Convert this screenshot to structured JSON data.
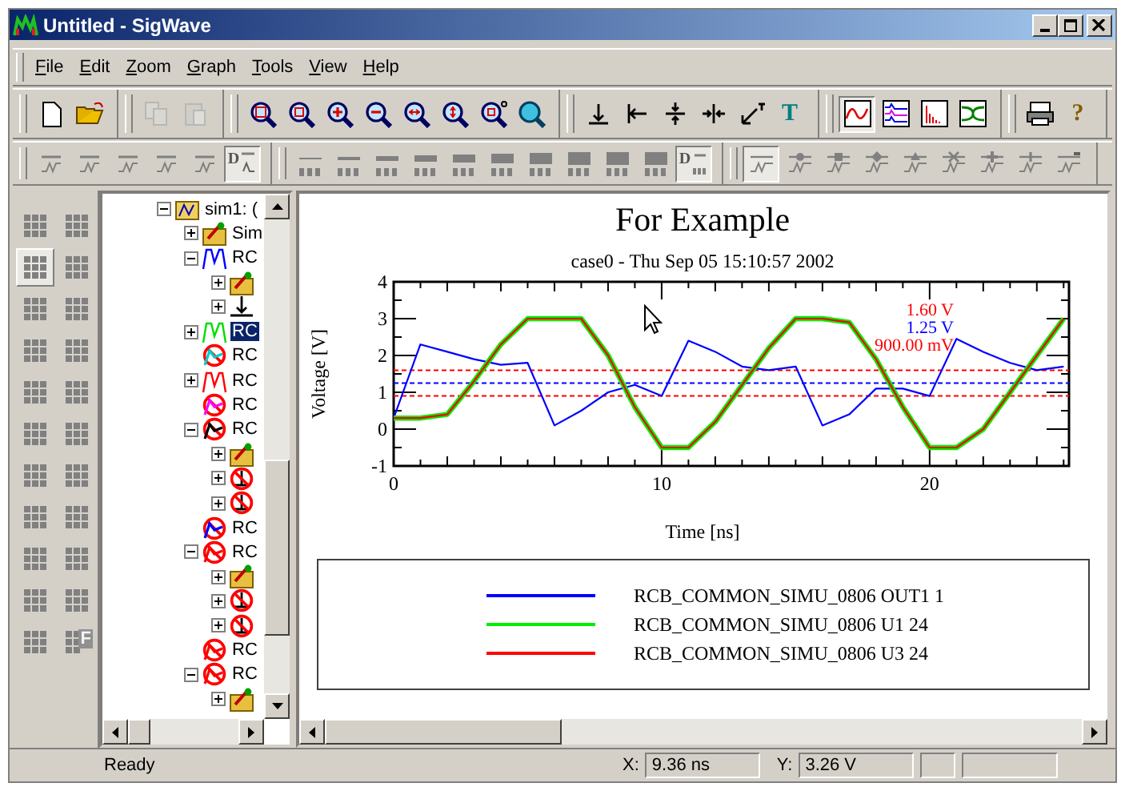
{
  "window": {
    "title": "Untitled - SigWave",
    "controls": [
      {
        "kind": "minimize"
      },
      {
        "kind": "maximize"
      },
      {
        "kind": "close"
      }
    ]
  },
  "menu": [
    {
      "label": "File"
    },
    {
      "label": "Edit"
    },
    {
      "label": "Zoom"
    },
    {
      "label": "Graph"
    },
    {
      "label": "Tools"
    },
    {
      "label": "View"
    },
    {
      "label": "Help"
    }
  ],
  "toolbars": [
    [
      {
        "buttons": [
          {
            "kind": "new",
            "pressed": false,
            "disabled": false
          },
          {
            "kind": "open",
            "pressed": false,
            "disabled": false
          }
        ]
      },
      {
        "buttons": [
          {
            "kind": "copy",
            "pressed": false,
            "disabled": true
          },
          {
            "kind": "paste",
            "pressed": false,
            "disabled": true
          }
        ]
      },
      {
        "buttons": [
          {
            "kind": "zoom-box",
            "pressed": false,
            "disabled": false
          },
          {
            "kind": "zoom-fit",
            "pressed": false,
            "disabled": false
          },
          {
            "kind": "zoom-in",
            "pressed": false,
            "disabled": false
          },
          {
            "kind": "zoom-out",
            "pressed": false,
            "disabled": false
          },
          {
            "kind": "zoom-x",
            "pressed": false,
            "disabled": false
          },
          {
            "kind": "zoom-y",
            "pressed": false,
            "disabled": false
          },
          {
            "kind": "zoom-step",
            "pressed": false,
            "disabled": false
          },
          {
            "kind": "zoom-all",
            "pressed": false,
            "disabled": false
          }
        ]
      },
      {
        "buttons": [
          {
            "kind": "marker-bottom",
            "pressed": false,
            "disabled": false
          },
          {
            "kind": "marker-left",
            "pressed": false,
            "disabled": false
          },
          {
            "kind": "marker-vcenter",
            "pressed": false,
            "disabled": false
          },
          {
            "kind": "marker-hcenter",
            "pressed": false,
            "disabled": false
          },
          {
            "kind": "marker-arrow",
            "pressed": false,
            "disabled": false
          },
          {
            "kind": "text-tool",
            "glyph": "T",
            "pressed": false,
            "disabled": false
          }
        ]
      },
      {
        "buttons": [
          {
            "kind": "view-wave",
            "pressed": true,
            "disabled": false
          },
          {
            "kind": "view-multi",
            "pressed": false,
            "disabled": false
          },
          {
            "kind": "view-spectrum",
            "pressed": false,
            "disabled": false
          },
          {
            "kind": "view-eye",
            "pressed": false,
            "disabled": false
          }
        ]
      },
      {
        "buttons": [
          {
            "kind": "print",
            "pressed": false,
            "disabled": false
          },
          {
            "kind": "help",
            "glyph": "?",
            "pressed": false,
            "disabled": false
          }
        ]
      }
    ],
    [
      {
        "buttons": [
          {
            "kind": "trace",
            "pressed": false,
            "disabled": false
          },
          {
            "kind": "trace",
            "pressed": false,
            "disabled": false
          },
          {
            "kind": "trace",
            "pressed": false,
            "disabled": false
          },
          {
            "kind": "trace",
            "pressed": false,
            "disabled": false
          },
          {
            "kind": "trace",
            "pressed": false,
            "disabled": false
          },
          {
            "kind": "label-trace",
            "glyph": "D",
            "pressed": true,
            "disabled": false
          }
        ]
      },
      {
        "buttons": [
          {
            "kind": "bar",
            "pressed": false,
            "disabled": false
          },
          {
            "kind": "bar",
            "pressed": false,
            "disabled": false
          },
          {
            "kind": "bar",
            "pressed": false,
            "disabled": false
          },
          {
            "kind": "bar",
            "pressed": false,
            "disabled": false
          },
          {
            "kind": "bar",
            "pressed": false,
            "disabled": false
          },
          {
            "kind": "bar",
            "pressed": false,
            "disabled": false
          },
          {
            "kind": "bar",
            "pressed": false,
            "disabled": false
          },
          {
            "kind": "bar",
            "pressed": false,
            "disabled": false
          },
          {
            "kind": "bar",
            "pressed": false,
            "disabled": false
          },
          {
            "kind": "bar",
            "pressed": false,
            "disabled": false
          },
          {
            "kind": "label-bar",
            "glyph": "D",
            "pressed": true,
            "disabled": false
          }
        ]
      },
      {
        "buttons": [
          {
            "kind": "point-plain",
            "pressed": true,
            "disabled": false
          },
          {
            "kind": "point-dot",
            "pressed": false,
            "disabled": false
          },
          {
            "kind": "point-square",
            "pressed": false,
            "disabled": false
          },
          {
            "kind": "point-diamond",
            "pressed": false,
            "disabled": false
          },
          {
            "kind": "point-triangle",
            "pressed": false,
            "disabled": false
          },
          {
            "kind": "point-cross",
            "pressed": false,
            "disabled": false
          },
          {
            "kind": "point-plus",
            "pressed": false,
            "disabled": false
          },
          {
            "kind": "point-tick",
            "pressed": false,
            "disabled": false
          },
          {
            "kind": "point-dash",
            "pressed": false,
            "disabled": false
          }
        ]
      }
    ]
  ],
  "palette": [
    {
      "kind": "grid",
      "selected": false
    },
    {
      "kind": "grid",
      "selected": false
    },
    {
      "kind": "grid",
      "selected": true
    },
    {
      "kind": "grid",
      "selected": false
    },
    {
      "kind": "grid",
      "selected": false
    },
    {
      "kind": "grid",
      "selected": false
    },
    {
      "kind": "grid",
      "selected": false
    },
    {
      "kind": "grid",
      "selected": false
    },
    {
      "kind": "grid",
      "selected": false
    },
    {
      "kind": "grid",
      "selected": false
    },
    {
      "kind": "grid",
      "selected": false
    },
    {
      "kind": "grid",
      "selected": false
    },
    {
      "kind": "grid",
      "selected": false
    },
    {
      "kind": "grid",
      "selected": false
    },
    {
      "kind": "grid",
      "selected": false
    },
    {
      "kind": "grid",
      "selected": false
    },
    {
      "kind": "grid",
      "selected": false
    },
    {
      "kind": "grid",
      "selected": false
    },
    {
      "kind": "grid",
      "selected": false
    },
    {
      "kind": "grid",
      "selected": false
    },
    {
      "kind": "grid",
      "selected": false
    },
    {
      "kind": "grid-label",
      "glyph": "F",
      "selected": false
    }
  ],
  "tree": [
    {
      "label": "sim1: (",
      "kind": "simulation",
      "expandable": true,
      "expanded": true,
      "selected": false,
      "children": [
        {
          "label": "Sim",
          "kind": "folder",
          "expandable": true,
          "expanded": false,
          "selected": false
        },
        {
          "label": "RC",
          "kind": "wave",
          "color": "#0000ff",
          "expandable": true,
          "expanded": true,
          "selected": false,
          "children": [
            {
              "kind": "folder",
              "expandable": true,
              "expanded": false,
              "selected": false
            },
            {
              "kind": "ground",
              "expandable": true,
              "expanded": false,
              "selected": false
            }
          ]
        },
        {
          "label": "RC",
          "kind": "wave",
          "color": "#00dd00",
          "expandable": true,
          "expanded": false,
          "selected": true
        },
        {
          "label": "RC",
          "kind": "hidden-wave",
          "color": "#00cccc",
          "expandable": false,
          "selected": false
        },
        {
          "label": "RC",
          "kind": "wave",
          "color": "#ff0000",
          "expandable": true,
          "expanded": false,
          "selected": false
        },
        {
          "label": "RC",
          "kind": "hidden-wave",
          "color": "#ff00ff",
          "expandable": false,
          "selected": false
        },
        {
          "label": "RC",
          "kind": "hidden-wave",
          "color": "#000000",
          "expandable": true,
          "expanded": true,
          "selected": false,
          "children": [
            {
              "kind": "folder",
              "expandable": true,
              "expanded": false,
              "selected": false
            },
            {
              "kind": "hidden-ground",
              "expandable": true,
              "expanded": false,
              "selected": false
            },
            {
              "kind": "hidden-ground",
              "expandable": true,
              "expanded": false,
              "selected": false
            }
          ]
        },
        {
          "label": "RC",
          "kind": "hidden-wave",
          "color": "#0000ff",
          "expandable": false,
          "selected": false
        },
        {
          "label": "RC",
          "kind": "hidden-wave",
          "color": "#ff0000",
          "expandable": true,
          "expanded": true,
          "selected": false,
          "children": [
            {
              "kind": "folder",
              "expandable": true,
              "expanded": false,
              "selected": false
            },
            {
              "kind": "hidden-ground",
              "expandable": true,
              "expanded": false,
              "selected": false
            },
            {
              "kind": "hidden-ground",
              "expandable": true,
              "expanded": false,
              "selected": false
            }
          ]
        },
        {
          "label": "RC",
          "kind": "hidden-wave",
          "color": "#ff0000",
          "expandable": false,
          "selected": false
        },
        {
          "label": "RC",
          "kind": "hidden-wave",
          "color": "#ff0000",
          "expandable": true,
          "expanded": true,
          "selected": false,
          "children": [
            {
              "kind": "folder",
              "expandable": true,
              "expanded": false,
              "selected": false
            }
          ]
        }
      ]
    }
  ],
  "plot": {
    "subtitle": "case0 - Thu Sep 05 15:10:57 2002",
    "chart_data": {
      "type": "line",
      "title": "For Example",
      "xlabel": "Time [ns]",
      "ylabel": "Voltage [V]",
      "x": [
        0,
        1,
        2,
        3,
        4,
        5,
        6,
        7,
        8,
        9,
        10,
        11,
        12,
        13,
        14,
        15,
        16,
        17,
        18,
        19,
        20,
        21,
        22,
        23,
        24,
        25
      ],
      "series": [
        {
          "name": "RCB_COMMON_SIMU_0806 OUT1 1",
          "color": "#0000ff",
          "values": [
            0.3,
            2.3,
            2.1,
            1.9,
            1.75,
            1.8,
            0.1,
            0.5,
            1.0,
            1.2,
            0.9,
            2.4,
            2.1,
            1.7,
            1.6,
            1.7,
            0.1,
            0.4,
            1.1,
            1.1,
            0.9,
            2.45,
            2.1,
            1.8,
            1.6,
            1.7
          ]
        },
        {
          "name": "RCB_COMMON_SIMU_0806 U1 24",
          "color": "#00ee00",
          "values": [
            0.3,
            0.3,
            0.4,
            1.3,
            2.3,
            3.0,
            3.0,
            3.0,
            2.0,
            0.6,
            -0.5,
            -0.5,
            0.2,
            1.2,
            2.2,
            3.0,
            3.0,
            2.9,
            1.9,
            0.6,
            -0.5,
            -0.5,
            0.0,
            1.0,
            2.0,
            3.0
          ]
        },
        {
          "name": "RCB_COMMON_SIMU_0806 U3 24",
          "color": "#ff0000",
          "values": [
            0.3,
            0.3,
            0.4,
            1.3,
            2.3,
            3.0,
            3.0,
            3.0,
            2.0,
            0.6,
            -0.5,
            -0.5,
            0.2,
            1.2,
            2.2,
            3.0,
            3.0,
            2.9,
            1.9,
            0.6,
            -0.5,
            -0.5,
            0.0,
            1.0,
            2.0,
            3.0
          ]
        }
      ],
      "xlim": [
        0,
        25.2
      ],
      "ylim": [
        -1,
        4
      ],
      "xticks": [
        0,
        10,
        20
      ],
      "yticks": [
        -1,
        0,
        1,
        2,
        3,
        4
      ],
      "ref_lines": [
        {
          "axis": "y",
          "value": 1.6,
          "label": "1.60 V",
          "color": "#ff0000"
        },
        {
          "axis": "y",
          "value": 1.25,
          "label": "1.25 V",
          "color": "#0000ff"
        },
        {
          "axis": "y",
          "value": 0.9,
          "label": "900.00 mV",
          "color": "#ff0000"
        }
      ]
    }
  },
  "status_bar": {
    "text": "Ready",
    "x_label": "X:",
    "x_value": "9.36 ns",
    "y_label": "Y:",
    "y_value": "3.26 V"
  }
}
